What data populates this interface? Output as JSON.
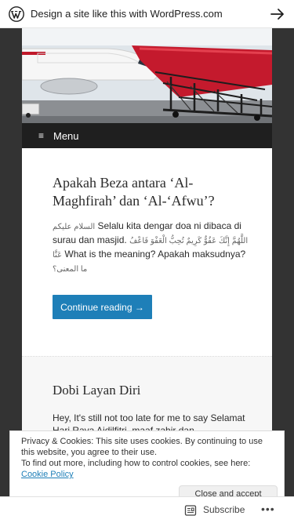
{
  "promo": {
    "text": "Design a site like this with WordPress.com",
    "logo_icon": "wordpress-logo-icon",
    "arrow_icon": "arrow-right-icon"
  },
  "nav": {
    "menu_icon": "≡",
    "menu_label": "Menu"
  },
  "posts": [
    {
      "title": "Apakah Beza antara ‘Al-Maghfirah’ dan ‘Al-‘Afwu’?",
      "excerpt_arabic_greeting": "السلام عليكم",
      "excerpt_part1": " Selalu kita dengar doa ni dibaca di surau dan masjid. ",
      "excerpt_arabic_dua": "اللَّهُمَّ إِنَّكَ عَفُوٌّ كَرِيمٌ تُحِبُّ الْعَفْوَ فَاعْفُ عَنَّا",
      "excerpt_part2": " What is the meaning? Apakah maksudnya? ",
      "excerpt_arabic_meaning": "ما المعنى؟",
      "continue_label": "Continue reading →"
    },
    {
      "title": "Dobi Layan Diri",
      "excerpt": "Hey, It's still not too late for me to say Selamat Hari Raya Aidilfitri, maaf zahir dan"
    }
  ],
  "cookie": {
    "line1": "Privacy & Cookies: This site uses cookies. By continuing to use this website, you agree to their use.",
    "line2": "To find out more, including how to control cookies, see here:",
    "link_label": "Cookie Policy",
    "close_label": "Close and accept"
  },
  "bottom_bar": {
    "subscribe_label": "Subscribe",
    "subscribe_icon": "reader-subscribe-icon",
    "more_label": "•••"
  },
  "colors": {
    "accent": "#1e7fb8",
    "menu_bg": "#1f1f1f",
    "page_bg": "#333333"
  }
}
